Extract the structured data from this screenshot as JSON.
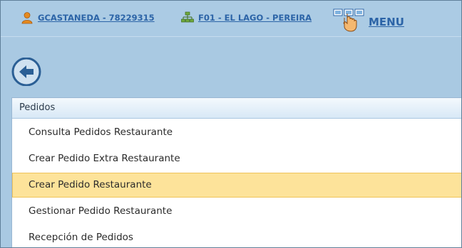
{
  "topbar": {
    "user": {
      "label": "GCASTANEDA - 78229315",
      "icon": "user-icon"
    },
    "branch": {
      "label": "F01 - EL LAGO - PEREIRA",
      "icon": "org-chart-icon"
    },
    "menu": {
      "label": "MENU",
      "icon": "hand-pointer-icon"
    }
  },
  "back_button": {
    "icon": "back-arrow-icon"
  },
  "panel": {
    "title": "Pedidos",
    "items": [
      {
        "label": "Consulta Pedidos Restaurante",
        "active": false
      },
      {
        "label": "Crear Pedido Extra Restaurante",
        "active": false
      },
      {
        "label": "Crear Pedido Restaurante",
        "active": true
      },
      {
        "label": "Gestionar Pedido Restaurante",
        "active": false
      },
      {
        "label": "Recepción de Pedidos",
        "active": false
      }
    ]
  },
  "colors": {
    "background": "#a9c9e2",
    "link": "#2c64a7",
    "highlight": "#fde39a"
  }
}
